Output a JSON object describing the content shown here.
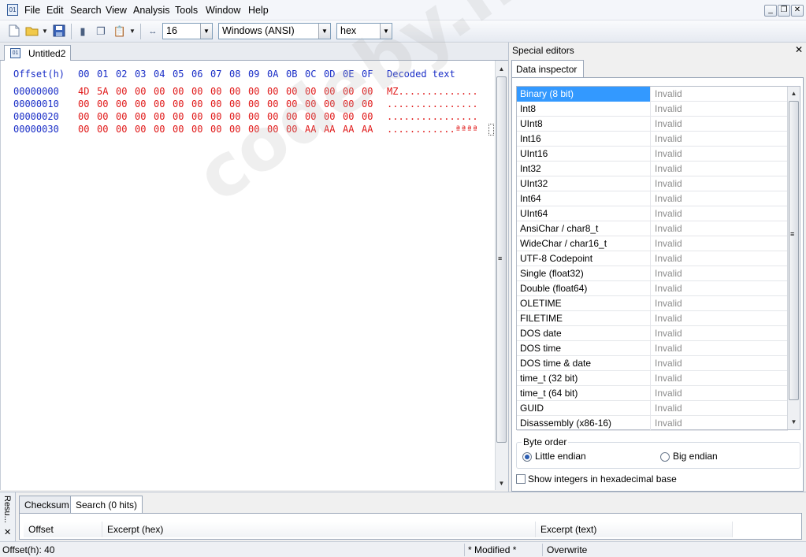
{
  "menubar": {
    "items": [
      "File",
      "Edit",
      "Search",
      "View",
      "Analysis",
      "Tools",
      "Window",
      "Help"
    ]
  },
  "toolbar": {
    "bytes_per_row": "16",
    "encoding": "Windows (ANSI)",
    "display_base": "hex"
  },
  "editor": {
    "tab_title": "Untitled2",
    "header_offset": "Offset(h)",
    "header_columns": [
      "00",
      "01",
      "02",
      "03",
      "04",
      "05",
      "06",
      "07",
      "08",
      "09",
      "0A",
      "0B",
      "0C",
      "0D",
      "0E",
      "0F"
    ],
    "header_decoded": "Decoded text",
    "rows": [
      {
        "offset": "00000000",
        "bytes": [
          "4D",
          "5A",
          "00",
          "00",
          "00",
          "00",
          "00",
          "00",
          "00",
          "00",
          "00",
          "00",
          "00",
          "00",
          "00",
          "00"
        ],
        "text": "MZ.............."
      },
      {
        "offset": "00000010",
        "bytes": [
          "00",
          "00",
          "00",
          "00",
          "00",
          "00",
          "00",
          "00",
          "00",
          "00",
          "00",
          "00",
          "00",
          "00",
          "00",
          "00"
        ],
        "text": "................"
      },
      {
        "offset": "00000020",
        "bytes": [
          "00",
          "00",
          "00",
          "00",
          "00",
          "00",
          "00",
          "00",
          "00",
          "00",
          "00",
          "00",
          "00",
          "00",
          "00",
          "00"
        ],
        "text": "................"
      },
      {
        "offset": "00000030",
        "bytes": [
          "00",
          "00",
          "00",
          "00",
          "00",
          "00",
          "00",
          "00",
          "00",
          "00",
          "00",
          "00",
          "AA",
          "AA",
          "AA",
          "AA"
        ],
        "text": "............ªªªª"
      }
    ]
  },
  "special_editors": {
    "title": "Special editors",
    "tab": "Data inspector",
    "rows": [
      {
        "name": "Binary (8 bit)",
        "value": "Invalid"
      },
      {
        "name": "Int8",
        "value": "Invalid"
      },
      {
        "name": "UInt8",
        "value": "Invalid"
      },
      {
        "name": "Int16",
        "value": "Invalid"
      },
      {
        "name": "UInt16",
        "value": "Invalid"
      },
      {
        "name": "Int32",
        "value": "Invalid"
      },
      {
        "name": "UInt32",
        "value": "Invalid"
      },
      {
        "name": "Int64",
        "value": "Invalid"
      },
      {
        "name": "UInt64",
        "value": "Invalid"
      },
      {
        "name": "AnsiChar / char8_t",
        "value": "Invalid"
      },
      {
        "name": "WideChar / char16_t",
        "value": "Invalid"
      },
      {
        "name": "UTF-8 Codepoint",
        "value": "Invalid"
      },
      {
        "name": "Single (float32)",
        "value": "Invalid"
      },
      {
        "name": "Double (float64)",
        "value": "Invalid"
      },
      {
        "name": "OLETIME",
        "value": "Invalid"
      },
      {
        "name": "FILETIME",
        "value": "Invalid"
      },
      {
        "name": "DOS date",
        "value": "Invalid"
      },
      {
        "name": "DOS time",
        "value": "Invalid"
      },
      {
        "name": "DOS time & date",
        "value": "Invalid"
      },
      {
        "name": "time_t (32 bit)",
        "value": "Invalid"
      },
      {
        "name": "time_t (64 bit)",
        "value": "Invalid"
      },
      {
        "name": "GUID",
        "value": "Invalid"
      },
      {
        "name": "Disassembly (x86-16)",
        "value": "Invalid"
      }
    ],
    "byte_order_label": "Byte order",
    "little_endian": "Little endian",
    "big_endian": "Big endian",
    "hex_base_label": "Show integers in hexadecimal base"
  },
  "results": {
    "side_label": "Resu...",
    "tabs": [
      "Checksum",
      "Search (0 hits)"
    ],
    "columns": [
      "Offset",
      "Excerpt (hex)",
      "Excerpt (text)"
    ]
  },
  "status": {
    "offset": "Offset(h): 40",
    "modified": "* Modified *",
    "mode": "Overwrite"
  },
  "watermark": "codeby.net"
}
